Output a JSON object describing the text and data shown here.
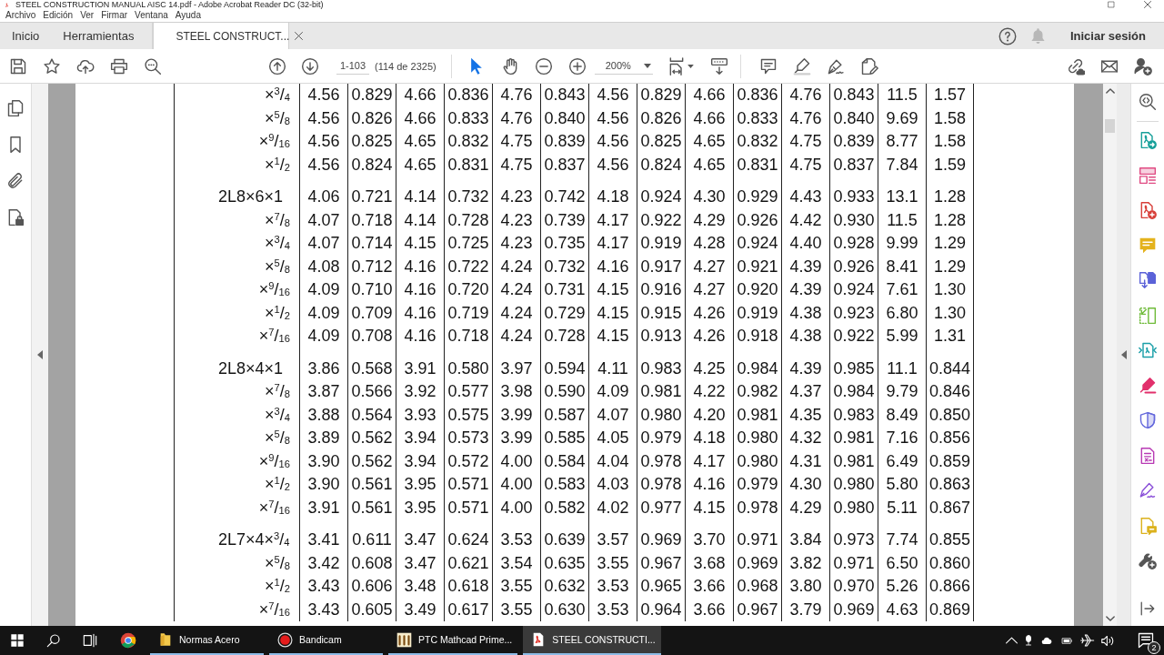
{
  "window": {
    "title": "STEEL CONSTRUCTION MANUAL AISC 14.pdf - Adobe Acrobat Reader DC (32-bit)"
  },
  "menu_bar": [
    "Archivo",
    "Edición",
    "Ver",
    "Firmar",
    "Ventana",
    "Ayuda"
  ],
  "tabs": [
    {
      "label": "Inicio",
      "kind": "home",
      "selected": false
    },
    {
      "label": "Herramientas",
      "kind": "tools",
      "selected": false
    },
    {
      "label": "STEEL CONSTRUCT...",
      "kind": "document",
      "selected": true
    }
  ],
  "sign_in": "Iniciar sesión",
  "toolbar": {
    "page_field": "1-103",
    "page_count": "(114 de 2325)",
    "zoom": "200%",
    "tools": [
      {
        "kind": "select",
        "selected": true
      },
      {
        "kind": "hand",
        "selected": false
      }
    ]
  },
  "table": {
    "groups": [
      {
        "rows": [
          {
            "kind": "size",
            "designation": "×$^{3}$/$_{4}$",
            "values": [
              "4.56",
              "0.829",
              "4.66",
              "0.836",
              "4.76",
              "0.843",
              "4.56",
              "0.829",
              "4.66",
              "0.836",
              "4.76",
              "0.843",
              "11.5",
              "1.57"
            ]
          },
          {
            "kind": "size",
            "designation": "×$^{5}$/$_{8}$",
            "values": [
              "4.56",
              "0.826",
              "4.66",
              "0.833",
              "4.76",
              "0.840",
              "4.56",
              "0.826",
              "4.66",
              "0.833",
              "4.76",
              "0.840",
              "9.69",
              "1.58"
            ]
          },
          {
            "kind": "size",
            "designation": "×$^{9}$/$_{16}$",
            "values": [
              "4.56",
              "0.825",
              "4.65",
              "0.832",
              "4.75",
              "0.839",
              "4.56",
              "0.825",
              "4.65",
              "0.832",
              "4.75",
              "0.839",
              "8.77",
              "1.58"
            ]
          },
          {
            "kind": "size",
            "designation": "×$^{1}$/$_{2}$",
            "values": [
              "4.56",
              "0.824",
              "4.65",
              "0.831",
              "4.75",
              "0.837",
              "4.56",
              "0.824",
              "4.65",
              "0.831",
              "4.75",
              "0.837",
              "7.84",
              "1.59"
            ]
          }
        ]
      },
      {
        "rows": [
          {
            "kind": "shape",
            "designation": "2L8×6×1",
            "values": [
              "4.06",
              "0.721",
              "4.14",
              "0.732",
              "4.23",
              "0.742",
              "4.18",
              "0.924",
              "4.30",
              "0.929",
              "4.43",
              "0.933",
              "13.1",
              "1.28"
            ]
          },
          {
            "kind": "size",
            "designation": "×$^{7}$/$_{8}$",
            "values": [
              "4.07",
              "0.718",
              "4.14",
              "0.728",
              "4.23",
              "0.739",
              "4.17",
              "0.922",
              "4.29",
              "0.926",
              "4.42",
              "0.930",
              "11.5",
              "1.28"
            ]
          },
          {
            "kind": "size",
            "designation": "×$^{3}$/$_{4}$",
            "values": [
              "4.07",
              "0.714",
              "4.15",
              "0.725",
              "4.23",
              "0.735",
              "4.17",
              "0.919",
              "4.28",
              "0.924",
              "4.40",
              "0.928",
              "9.99",
              "1.29"
            ]
          },
          {
            "kind": "size",
            "designation": "×$^{5}$/$_{8}$",
            "values": [
              "4.08",
              "0.712",
              "4.16",
              "0.722",
              "4.24",
              "0.732",
              "4.16",
              "0.917",
              "4.27",
              "0.921",
              "4.39",
              "0.926",
              "8.41",
              "1.29"
            ]
          },
          {
            "kind": "size",
            "designation": "×$^{9}$/$_{16}$",
            "values": [
              "4.09",
              "0.710",
              "4.16",
              "0.720",
              "4.24",
              "0.731",
              "4.15",
              "0.916",
              "4.27",
              "0.920",
              "4.39",
              "0.924",
              "7.61",
              "1.30"
            ]
          },
          {
            "kind": "size",
            "designation": "×$^{1}$/$_{2}$",
            "values": [
              "4.09",
              "0.709",
              "4.16",
              "0.719",
              "4.24",
              "0.729",
              "4.15",
              "0.915",
              "4.26",
              "0.919",
              "4.38",
              "0.923",
              "6.80",
              "1.30"
            ]
          },
          {
            "kind": "size",
            "designation": "×$^{7}$/$_{16}$",
            "values": [
              "4.09",
              "0.708",
              "4.16",
              "0.718",
              "4.24",
              "0.728",
              "4.15",
              "0.913",
              "4.26",
              "0.918",
              "4.38",
              "0.922",
              "5.99",
              "1.31"
            ]
          }
        ]
      },
      {
        "rows": [
          {
            "kind": "shape",
            "designation": "2L8×4×1",
            "values": [
              "3.86",
              "0.568",
              "3.91",
              "0.580",
              "3.97",
              "0.594",
              "4.11",
              "0.983",
              "4.25",
              "0.984",
              "4.39",
              "0.985",
              "11.1",
              "0.844"
            ]
          },
          {
            "kind": "size",
            "designation": "×$^{7}$/$_{8}$",
            "values": [
              "3.87",
              "0.566",
              "3.92",
              "0.577",
              "3.98",
              "0.590",
              "4.09",
              "0.981",
              "4.22",
              "0.982",
              "4.37",
              "0.984",
              "9.79",
              "0.846"
            ]
          },
          {
            "kind": "size",
            "designation": "×$^{3}$/$_{4}$",
            "values": [
              "3.88",
              "0.564",
              "3.93",
              "0.575",
              "3.99",
              "0.587",
              "4.07",
              "0.980",
              "4.20",
              "0.981",
              "4.35",
              "0.983",
              "8.49",
              "0.850"
            ]
          },
          {
            "kind": "size",
            "designation": "×$^{5}$/$_{8}$",
            "values": [
              "3.89",
              "0.562",
              "3.94",
              "0.573",
              "3.99",
              "0.585",
              "4.05",
              "0.979",
              "4.18",
              "0.980",
              "4.32",
              "0.981",
              "7.16",
              "0.856"
            ]
          },
          {
            "kind": "size",
            "designation": "×$^{9}$/$_{16}$",
            "values": [
              "3.90",
              "0.562",
              "3.94",
              "0.572",
              "4.00",
              "0.584",
              "4.04",
              "0.978",
              "4.17",
              "0.980",
              "4.31",
              "0.981",
              "6.49",
              "0.859"
            ]
          },
          {
            "kind": "size",
            "designation": "×$^{1}$/$_{2}$",
            "values": [
              "3.90",
              "0.561",
              "3.95",
              "0.571",
              "4.00",
              "0.583",
              "4.03",
              "0.978",
              "4.16",
              "0.979",
              "4.30",
              "0.980",
              "5.80",
              "0.863"
            ]
          },
          {
            "kind": "size",
            "designation": "×$^{7}$/$_{16}$",
            "values": [
              "3.91",
              "0.561",
              "3.95",
              "0.571",
              "4.00",
              "0.582",
              "4.02",
              "0.977",
              "4.15",
              "0.978",
              "4.29",
              "0.980",
              "5.11",
              "0.867"
            ]
          }
        ]
      },
      {
        "rows": [
          {
            "kind": "shape",
            "designation": "2L7×4×$^{3}$/$_{4}$",
            "values": [
              "3.41",
              "0.611",
              "3.47",
              "0.624",
              "3.53",
              "0.639",
              "3.57",
              "0.969",
              "3.70",
              "0.971",
              "3.84",
              "0.973",
              "7.74",
              "0.855"
            ]
          },
          {
            "kind": "size",
            "designation": "×$^{5}$/$_{8}$",
            "values": [
              "3.42",
              "0.608",
              "3.47",
              "0.621",
              "3.54",
              "0.635",
              "3.55",
              "0.967",
              "3.68",
              "0.969",
              "3.82",
              "0.971",
              "6.50",
              "0.860"
            ]
          },
          {
            "kind": "size",
            "designation": "×$^{1}$/$_{2}$",
            "values": [
              "3.43",
              "0.606",
              "3.48",
              "0.618",
              "3.55",
              "0.632",
              "3.53",
              "0.965",
              "3.66",
              "0.968",
              "3.80",
              "0.970",
              "5.26",
              "0.866"
            ]
          },
          {
            "kind": "size",
            "designation": "×$^{7}$/$_{16}$",
            "values": [
              "3.43",
              "0.605",
              "3.49",
              "0.617",
              "3.55",
              "0.630",
              "3.53",
              "0.964",
              "3.66",
              "0.967",
              "3.79",
              "0.969",
              "4.63",
              "0.869"
            ]
          }
        ]
      }
    ]
  },
  "taskbar": {
    "apps": [
      {
        "label": "Normas Acero",
        "kind": "folder",
        "selected": false
      },
      {
        "label": "Bandicam",
        "kind": "record",
        "selected": false
      },
      {
        "label": "PTC Mathcad Prime...",
        "kind": "tile",
        "selected": false
      },
      {
        "label": "STEEL CONSTRUCTI...",
        "kind": "pdf",
        "selected": true
      }
    ],
    "notification_count": "2"
  }
}
